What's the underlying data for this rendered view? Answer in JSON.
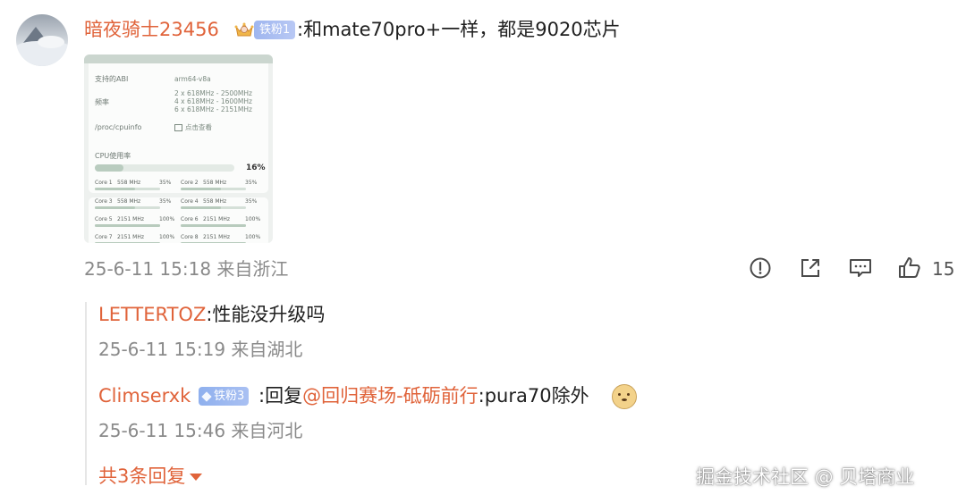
{
  "comment": {
    "username": "暗夜骑士23456",
    "fan_badge": "铁粉1",
    "text": ":和mate70pro+一样，都是9020芯片",
    "timestamp": "25-6-11 15:18 来自浙江",
    "like_count": "15",
    "actions": {
      "report_icon": "exclamation-circle-icon",
      "share_icon": "share-icon",
      "comment_icon": "comment-icon",
      "like_icon": "thumbs-up-icon"
    }
  },
  "screenshot": {
    "abi_label": "支持的ABI",
    "abi_value": "arm64-v8a",
    "freq_label": "频率",
    "freq_values": [
      "2 x 618MHz - 2500MHz",
      "4 x 618MHz - 1600MHz",
      "6 x 618MHz - 2151MHz"
    ],
    "cpuinfo_label": "/proc/cpuinfo",
    "cpuinfo_action": "点击查看",
    "cpu_usage_label": "CPU使用率",
    "cpu_usage_value": "16%",
    "cpu_usage_fraction": 0.16,
    "cores": [
      {
        "name": "Core 1",
        "freq": "558 MHz",
        "pct": "35%",
        "fraction": 0.35
      },
      {
        "name": "Core 2",
        "freq": "558 MHz",
        "pct": "35%",
        "fraction": 0.35
      },
      {
        "name": "Core 3",
        "freq": "558 MHz",
        "pct": "35%",
        "fraction": 0.35
      },
      {
        "name": "Core 4",
        "freq": "558 MHz",
        "pct": "35%",
        "fraction": 0.35
      },
      {
        "name": "Core 5",
        "freq": "2151 MHz",
        "pct": "100%",
        "fraction": 1.0
      },
      {
        "name": "Core 6",
        "freq": "2151 MHz",
        "pct": "100%",
        "fraction": 1.0
      },
      {
        "name": "Core 7",
        "freq": "2151 MHz",
        "pct": "100%",
        "fraction": 1.0
      },
      {
        "name": "Core 8",
        "freq": "2151 MHz",
        "pct": "100%",
        "fraction": 1.0
      }
    ]
  },
  "replies": [
    {
      "username": "LETTERTOZ",
      "text": ":性能没升级吗",
      "timestamp": "25-6-11 15:19 来自湖北"
    },
    {
      "username": "Climserxk",
      "fan_badge": "铁粉3",
      "prefix": ":回复",
      "mention": "@回归赛场-砥砺前行",
      "text": ":pura70除外",
      "emoji": "doge-emoji-icon",
      "timestamp": "25-6-11 15:46 来自河北"
    }
  ],
  "more_replies": "共3条回复",
  "watermark": "掘金技术社区 @ 贝塔商业",
  "colors": {
    "accent": "#e0633a",
    "meta_text": "#8a8a8a",
    "badge_blue": "#9fb6ef"
  }
}
